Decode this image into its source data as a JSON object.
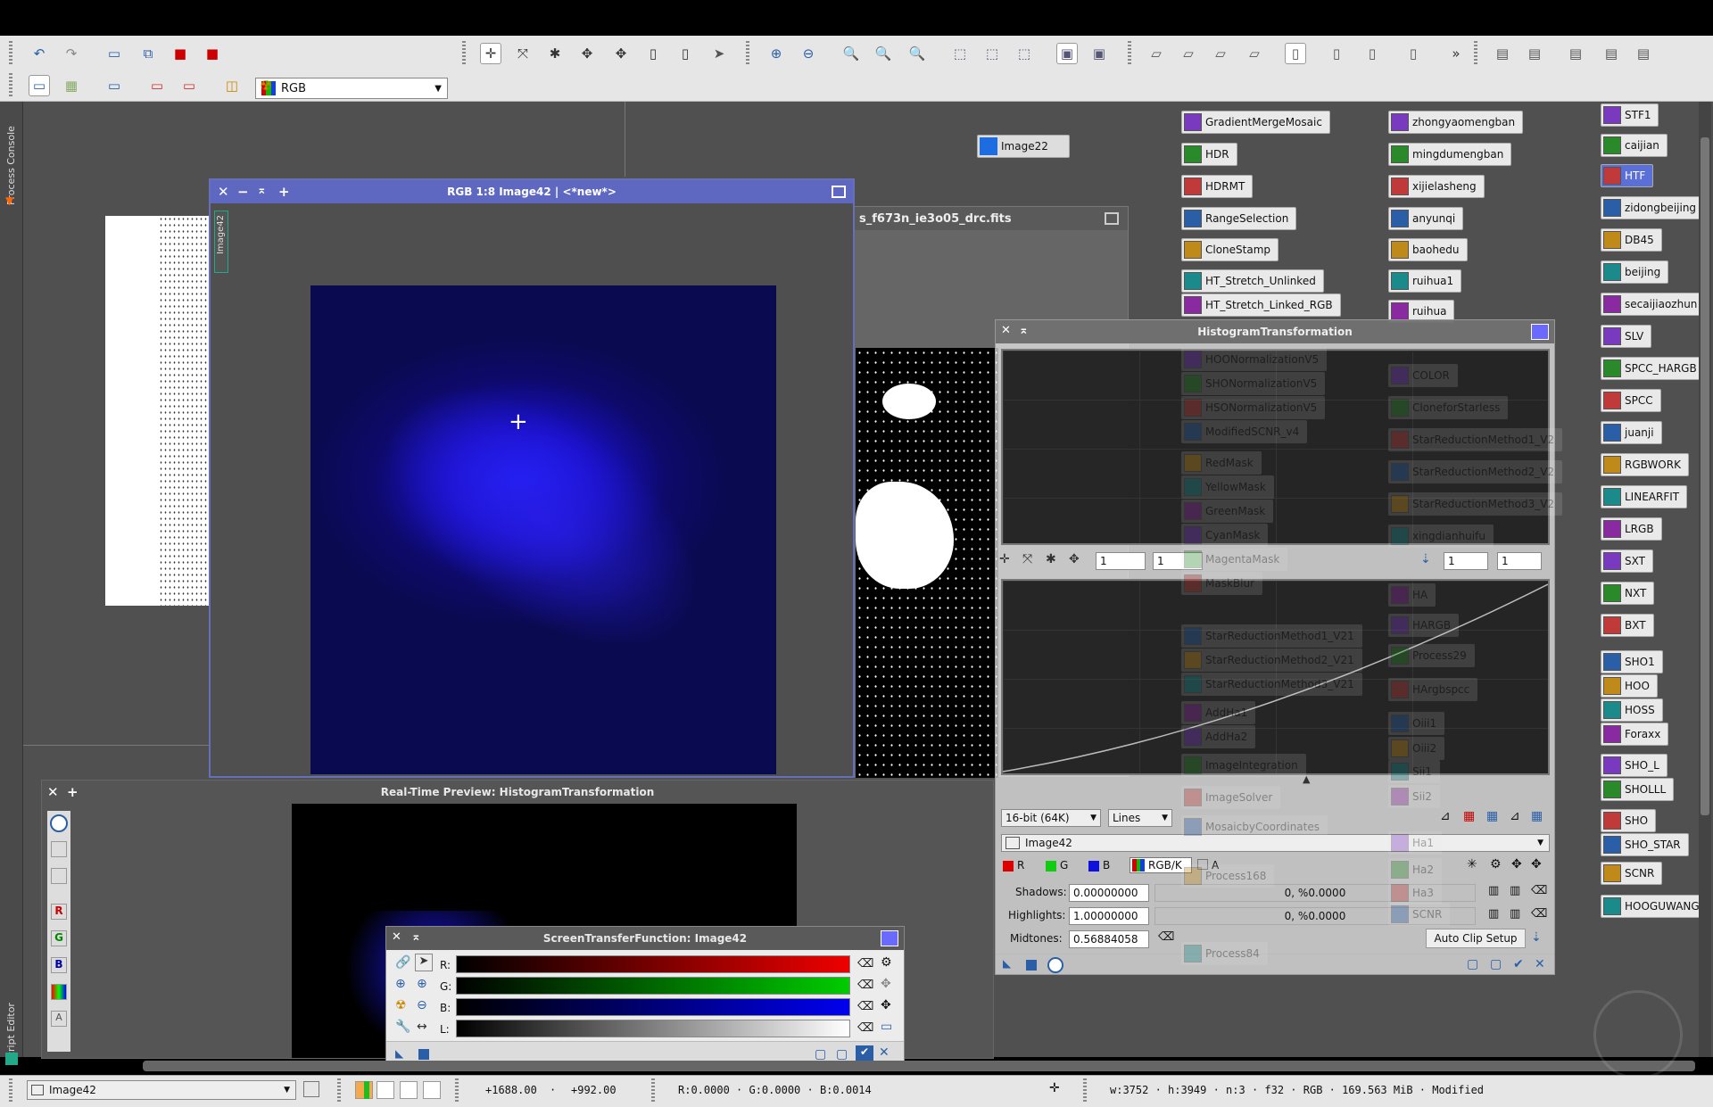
{
  "toolbar": {
    "color_mode_label": "RGB",
    "colors": {
      "red": "#d40000",
      "green": "#17b400",
      "blue": "#1040e0"
    }
  },
  "side_tabs": {
    "process_console": "Process Console",
    "script_editor": "Script Editor"
  },
  "image_window": {
    "title": "RGB 1:8 Image42 | <*new*>",
    "side_label": "Image42"
  },
  "second_window": {
    "title": "s_f673n_ie3o05_drc.fits"
  },
  "image22_icon": {
    "label": "Image22"
  },
  "preview_window": {
    "title": "Real-Time Preview: HistogramTransformation"
  },
  "stf_window": {
    "title": "ScreenTransferFunction: Image42",
    "channels": [
      "R:",
      "G:",
      "B:",
      "L:"
    ]
  },
  "histogram_window": {
    "title": "HistogramTransformation",
    "zoom_h": "1",
    "zoom_v": "1",
    "zoom_h2": "1",
    "zoom_v2": "1",
    "bit_depth": "16-bit (64K)",
    "graph_style": "Lines",
    "view": "Image42",
    "channel_r": "R",
    "channel_g": "G",
    "channel_b": "B",
    "channel_rgbk": "RGB/K",
    "channel_a": "A",
    "shadows_label": "Shadows:",
    "shadows_value": "0.00000000",
    "shadows_clip": "0, %0.0000",
    "highlights_label": "Highlights:",
    "highlights_value": "1.00000000",
    "highlights_clip": "0, %0.0000",
    "midtones_label": "Midtones:",
    "midtones_value": "0.56884058",
    "auto_clip_label": "Auto Clip Setup"
  },
  "process_icons_col1": [
    "GradientMergeMosaic",
    "HDR",
    "HDRMT",
    "RangeSelection",
    "CloneStamp",
    "HT_Stretch_Unlinked",
    "HT_Stretch_Linked_RGB"
  ],
  "process_icons_col1_faded": [
    "HOONormalizationV5",
    "SHONormalizationV5",
    "HSONormalizationV5",
    "ModifiedSCNR_v4",
    "RedMask",
    "YellowMask",
    "GreenMask",
    "CyanMask",
    "MagentaMask",
    "MaskBlur",
    "StarReductionMethod1_V21",
    "StarReductionMethod2_V21",
    "StarReductionMethod3_V21",
    "AddHa1",
    "AddHa2",
    "ImageIntegration",
    "ImageSolver",
    "MosaicbyCoordinates",
    "Process168",
    "Process84"
  ],
  "process_icons_col2": [
    "zhongyaomengban",
    "mingdumengban",
    "xijielasheng",
    "anyunqi",
    "baohedu",
    "ruihua1",
    "ruihua"
  ],
  "process_icons_col2_faded": [
    "COLOR",
    "CloneforStarless",
    "StarReductionMethod1_V2",
    "StarReductionMethod2_V2",
    "StarReductionMethod3_V2",
    "xingdianhuifu",
    "HA",
    "HARGB",
    "Process29",
    "HArgbspcc",
    "Oiii1",
    "Oiii2",
    "Sii1",
    "Sii2",
    "Ha1",
    "Ha2",
    "Ha3",
    "SCNR"
  ],
  "process_icons_col3": [
    "STF1",
    "caijian",
    "HTF",
    "zidongbeijing",
    "DB45",
    "beijing",
    "secaijiaozhun",
    "SLV",
    "SPCC_HARGB",
    "SPCC",
    "juanji",
    "RGBWORK",
    "LINEARFIT",
    "LRGB",
    "SXT",
    "NXT",
    "BXT",
    "SHO1",
    "HOO",
    "HOSS",
    "Foraxx",
    "SHO_L",
    "SHOLLL",
    "SHO",
    "SHO_STAR",
    "SCNR",
    "HOOGUWANG"
  ],
  "statusbar": {
    "view": "Image42",
    "x": "+1688.00",
    "y": "+992.00",
    "rgb": "R:0.0000 · G:0.0000 · B:0.0014",
    "info": "w:3752 · h:3949 · n:3 · f32 · RGB · 169.563 MiB · Modified"
  }
}
